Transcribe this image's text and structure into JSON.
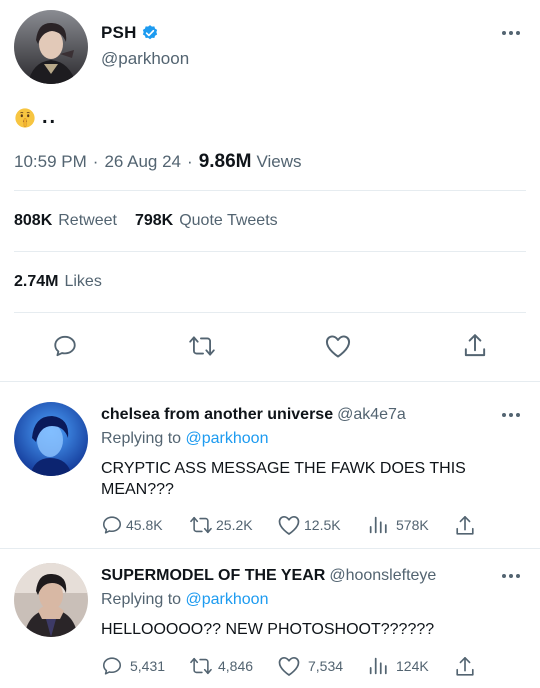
{
  "main_tweet": {
    "author": {
      "display_name": "PSH",
      "handle": "@parkhoon",
      "verified": true
    },
    "text": "..",
    "emoji": "shushing-face-emoji",
    "time": "10:59 PM",
    "date": "26 Aug 24",
    "views_count": "9.86M",
    "views_label": "Views",
    "retweets_count": "808K",
    "retweets_label": "Retweet",
    "quotes_count": "798K",
    "quotes_label": "Quote Tweets",
    "likes_count": "2.74M",
    "likes_label": "Likes",
    "actions": [
      "reply-icon",
      "retweet-icon",
      "like-icon",
      "share-icon"
    ]
  },
  "separator": "·",
  "replies": [
    {
      "display_name": "chelsea from another universe",
      "handle": "@ak4e7a",
      "replying_prefix": "Replying to",
      "replying_to": "@parkhoon",
      "text_line1": "CRYPTIC ASS MESSAGE THE FAWK DOES THIS",
      "text_line2": "MEAN???",
      "replies": "45.8K",
      "retweets": "25.2K",
      "likes": "12.5K",
      "views": "578K"
    },
    {
      "display_name": "SUPERMODEL OF THE YEAR",
      "handle": "@hoonslefteye",
      "replying_prefix": "Replying to",
      "replying_to": "@parkhoon",
      "text_line1": "HELLOOOOO?? NEW PHOTOSHOOT??????",
      "replies": "5,431",
      "retweets": "4,846",
      "likes": "7,534",
      "views": "124K"
    }
  ],
  "colors": {
    "accent": "#1d9bf0",
    "text_primary": "#0f1419",
    "text_secondary": "#536471",
    "divider": "#e6ecf0"
  }
}
